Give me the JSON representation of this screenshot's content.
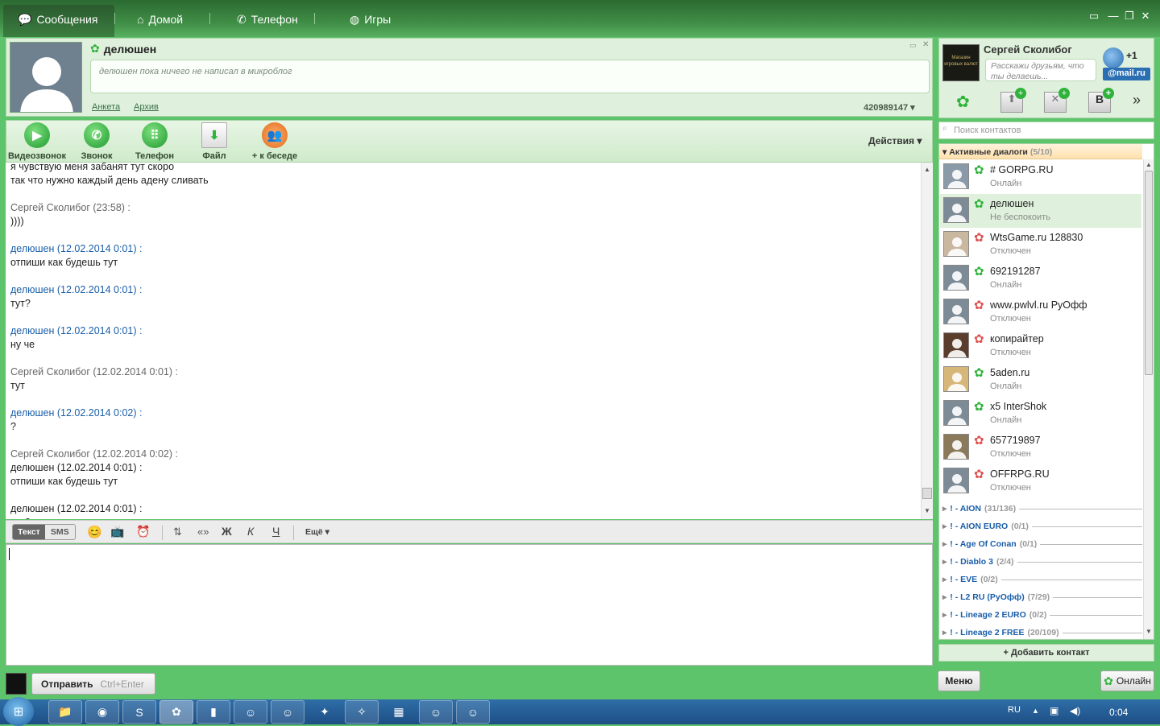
{
  "nav": {
    "tabs": [
      {
        "label": "Сообщения",
        "icon": "speech-bubble-icon"
      },
      {
        "label": "Домой",
        "icon": "home-icon"
      },
      {
        "label": "Телефон",
        "icon": "phone-icon"
      },
      {
        "label": "Игры",
        "icon": "globe-icon"
      }
    ]
  },
  "window": {
    "minimize": "▭",
    "restore": "—",
    "maximize": "❐",
    "close": "✕"
  },
  "profile": {
    "name": "делюшен",
    "microblog": "делюшен пока ничего не написал в микроблог",
    "links": [
      "Анкета",
      "Архив"
    ],
    "uin": "420989147 ▾"
  },
  "toolbar": {
    "buttons": [
      "Видеозвонок",
      "Звонок",
      "Телефон",
      "Файл",
      "+ к беседе"
    ],
    "actions": "Действия ▾"
  },
  "chat": {
    "lines": [
      {
        "t": "text",
        "v": "я чувствую меня забанят тут скоро"
      },
      {
        "t": "text",
        "v": "так что нужно каждый день адену сливать"
      },
      {
        "t": "blank",
        "v": ""
      },
      {
        "t": "me",
        "v": "Сергей Сколибог (23:58) :"
      },
      {
        "t": "text",
        "v": "))))"
      },
      {
        "t": "blank",
        "v": ""
      },
      {
        "t": "them",
        "v": "делюшен (12.02.2014 0:01) :"
      },
      {
        "t": "text",
        "v": "отпиши как будешь тут"
      },
      {
        "t": "blank",
        "v": ""
      },
      {
        "t": "them",
        "v": "делюшен (12.02.2014 0:01) :"
      },
      {
        "t": "text",
        "v": "тут?"
      },
      {
        "t": "blank",
        "v": ""
      },
      {
        "t": "them",
        "v": "делюшен (12.02.2014 0:01) :"
      },
      {
        "t": "text",
        "v": "ну че"
      },
      {
        "t": "blank",
        "v": ""
      },
      {
        "t": "me",
        "v": "Сергей Сколибог (12.02.2014 0:01) :"
      },
      {
        "t": "text",
        "v": "тут"
      },
      {
        "t": "blank",
        "v": ""
      },
      {
        "t": "them",
        "v": "делюшен (12.02.2014 0:02) :"
      },
      {
        "t": "text",
        "v": "?"
      },
      {
        "t": "blank",
        "v": ""
      },
      {
        "t": "me",
        "v": "Сергей Сколибог (12.02.2014 0:02) :"
      },
      {
        "t": "text",
        "v": "делюшен (12.02.2014 0:01) :"
      },
      {
        "t": "text",
        "v": "отпиши как будешь тут"
      },
      {
        "t": "blank",
        "v": ""
      },
      {
        "t": "text",
        "v": "делюшен (12.02.2014 0:01) :"
      },
      {
        "t": "text",
        "v": "тут?"
      }
    ]
  },
  "format": {
    "mode_text": "Текст",
    "mode_sms": "SMS",
    "more": "Ещё ▾",
    "bold": "Ж",
    "italic": "К",
    "underline": "Ч",
    "quote": "«»"
  },
  "send": {
    "label": "Отправить",
    "shortcut": "Ctrl+Enter"
  },
  "me": {
    "name": "Сергей Сколибог",
    "status_placeholder": "Расскажи друзьям, что ты делаешь...",
    "mail_badge": "+1",
    "mail_label": "@mail.ru",
    "avatar_text": "Магазин игровых валют"
  },
  "search": {
    "placeholder": "Поиск контактов"
  },
  "active_dialogs": {
    "label": "Активные диалоги",
    "count": "(5/10)"
  },
  "contacts": [
    {
      "name": "# GORPG.RU",
      "status": "Онлайн",
      "state": "online",
      "ava": "#8a9aa8"
    },
    {
      "name": "делюшен",
      "status": "Не беспокоить",
      "state": "dnd",
      "ava": "#7d8b97"
    },
    {
      "name": "WtsGame.ru 128830",
      "status": "Отключен",
      "state": "offline",
      "ava": "#c9b7a0"
    },
    {
      "name": "692191287",
      "status": "Онлайн",
      "state": "online",
      "ava": "#7d8b97"
    },
    {
      "name": "www.pwlvl.ru  РуОфф",
      "status": "Отключен",
      "state": "offline",
      "ava": "#7d8b97"
    },
    {
      "name": "копирайтер",
      "status": "Отключен",
      "state": "offline",
      "ava": "#5a3d2c"
    },
    {
      "name": "5aden.ru",
      "status": "Онлайн",
      "state": "online",
      "ava": "#d7b779"
    },
    {
      "name": "x5 InterShok",
      "status": "Онлайн",
      "state": "online",
      "ava": "#7d8b97"
    },
    {
      "name": "657719897",
      "status": "Отключен",
      "state": "offline",
      "ava": "#8b7a5a"
    },
    {
      "name": "OFFRPG.RU",
      "status": "Отключен",
      "state": "offline",
      "ava": "#7d8b97"
    }
  ],
  "groups": [
    {
      "name": "! - AION",
      "count": "(31/136)"
    },
    {
      "name": "! - AION EURO",
      "count": "(0/1)"
    },
    {
      "name": "! - Age Of Conan",
      "count": "(0/1)"
    },
    {
      "name": "! - Diablo 3",
      "count": "(2/4)"
    },
    {
      "name": "! - EVE",
      "count": "(0/2)"
    },
    {
      "name": "! - L2 RU (РуОфф)",
      "count": "(7/29)"
    },
    {
      "name": "! - Lineage 2 EURO",
      "count": "(0/2)"
    },
    {
      "name": "! - Lineage 2 FREE",
      "count": "(20/109)"
    }
  ],
  "add_contact": "+ Добавить контакт",
  "bottom": {
    "menu": "Меню",
    "online": "Онлайн"
  },
  "taskbar": {
    "lang": "RU",
    "clock": "0:04"
  },
  "colors": {
    "accent_green": "#5ec46b",
    "link_blue": "#1a5ea8",
    "online": "#2fb33b",
    "offline": "#e05050"
  }
}
